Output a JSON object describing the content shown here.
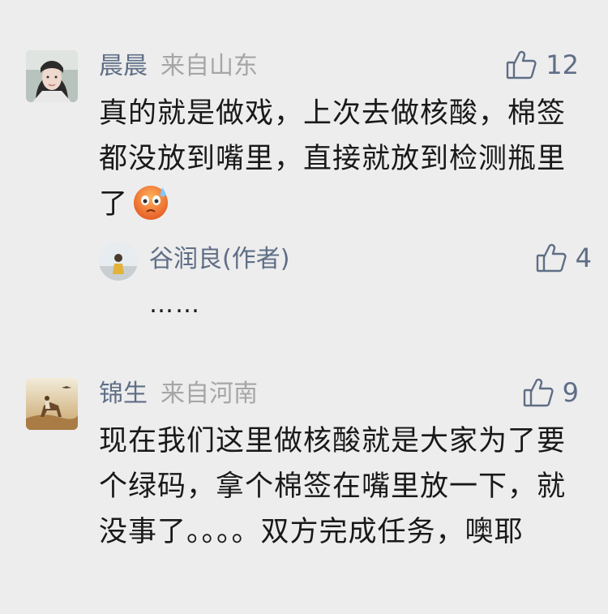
{
  "comments": [
    {
      "nick": "晨晨",
      "location": "来自山东",
      "likes": "12",
      "text": "真的就是做戏，上次去做核酸，棉签都没放到嘴里，直接就放到检测瓶里了",
      "emoji": "sweat-emoji",
      "reply": {
        "nick": "谷润良(作者)",
        "likes": "4",
        "text": "……"
      }
    },
    {
      "nick": "锦生",
      "location": "来自河南",
      "likes": "9",
      "text": "现在我们这里做核酸就是大家为了要个绿码，拿个棉签在嘴里放一下，就没事了。。。。双方完成任务，噢耶"
    }
  ],
  "colors": {
    "background": "#ededed",
    "nickname": "#5f6e86",
    "location": "#a6a6a6",
    "text": "#191919"
  },
  "icons": [
    "thumbs-up-icon",
    "sweat-emoji"
  ]
}
